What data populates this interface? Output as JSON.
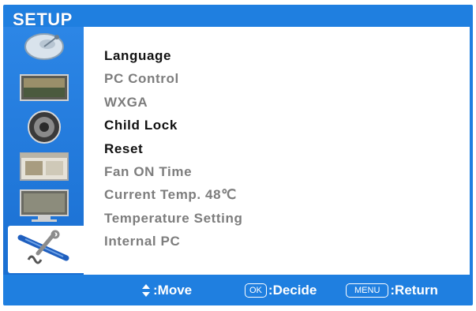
{
  "header": {
    "title": "SETUP"
  },
  "sidebar": {
    "items": [
      {
        "icon": "satellite-dish-icon"
      },
      {
        "icon": "picture-icon"
      },
      {
        "icon": "speaker-icon"
      },
      {
        "icon": "window-icon"
      },
      {
        "icon": "monitor-icon"
      },
      {
        "icon": "tools-icon",
        "active": true
      }
    ]
  },
  "menu": {
    "items": [
      {
        "label": "Language",
        "enabled": true
      },
      {
        "label": "PC Control",
        "enabled": false
      },
      {
        "label": "WXGA",
        "enabled": false
      },
      {
        "label": "Child Lock",
        "enabled": true
      },
      {
        "label": "Reset",
        "enabled": true
      },
      {
        "label": "Fan ON Time",
        "enabled": false
      },
      {
        "label": "Current Temp. 48℃",
        "enabled": false
      },
      {
        "label": "Temperature Setting",
        "enabled": false
      },
      {
        "label": "Internal PC",
        "enabled": false
      }
    ]
  },
  "footer": {
    "move_label": ":Move",
    "ok_key": "OK",
    "decide_label": ":Decide",
    "menu_key": "MENU",
    "return_label": ":Return"
  },
  "colors": {
    "frame_blue": "#1f7fe0",
    "enabled_text": "#111111",
    "disabled_text": "#7d7d7d"
  }
}
